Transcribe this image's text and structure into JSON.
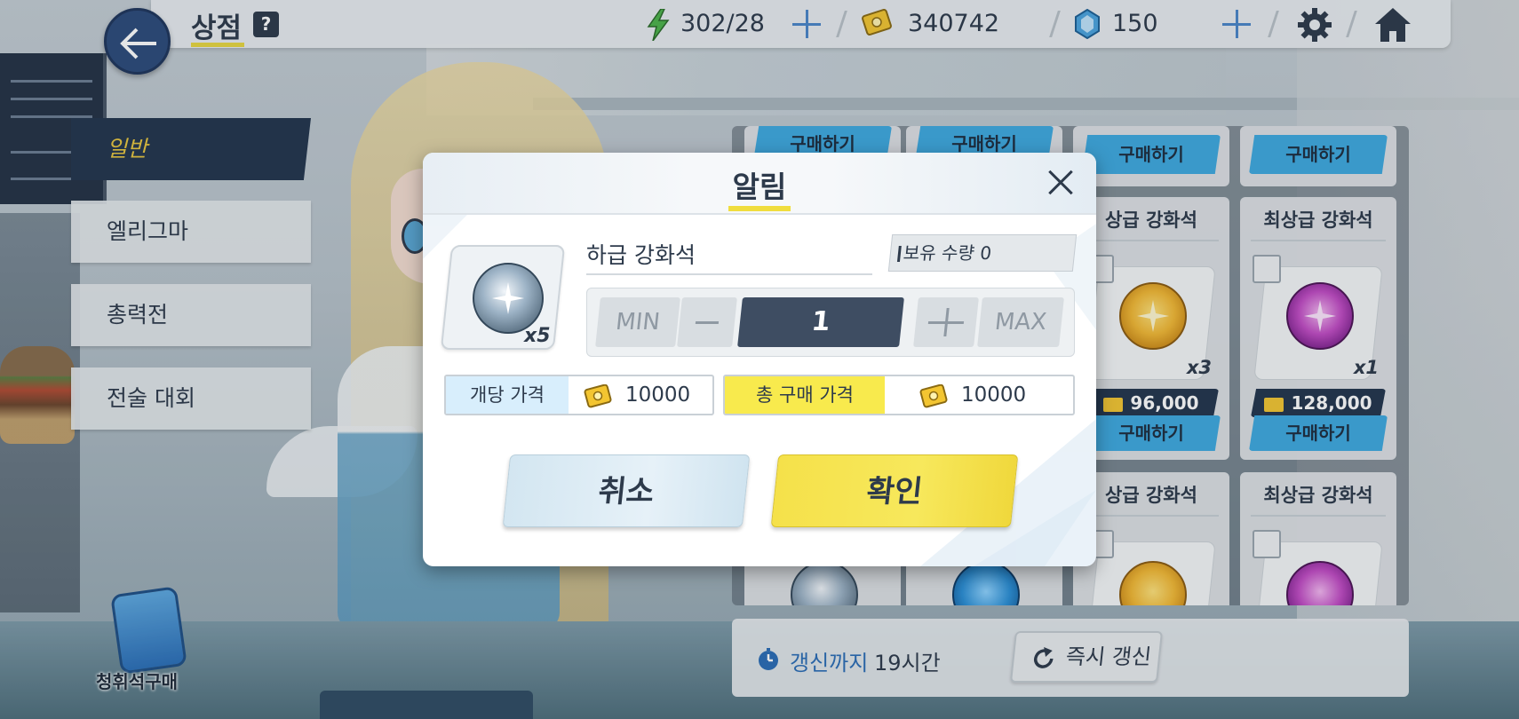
{
  "topbar": {
    "title": "상점",
    "help_label": "?",
    "ap": "302/28",
    "credits": "340742",
    "pyroxene": "150"
  },
  "tabs": [
    {
      "label": "일반",
      "active": true
    },
    {
      "label": "엘리그마",
      "active": false
    },
    {
      "label": "총력전",
      "active": false
    },
    {
      "label": "전술 대회",
      "active": false
    }
  ],
  "shop": {
    "buy_label": "구매하기",
    "cards": [
      {
        "name": "상급 강화석",
        "qty": "x3",
        "price": "96,000",
        "orb": "gold"
      },
      {
        "name": "최상급 강화석",
        "qty": "x1",
        "price": "128,000",
        "orb": "purple"
      },
      {
        "name": "상급 강화석",
        "orb": "gold"
      },
      {
        "name": "최상급 강화석",
        "orb": "purple"
      }
    ],
    "refresh_label": "갱신까지",
    "refresh_time": "19시간",
    "refresh_button": "즉시 갱신",
    "crystal_purchase": "청휘석구매"
  },
  "modal": {
    "title": "알림",
    "item_name": "하급 강화석",
    "item_qty": "x5",
    "owned_label": "보유 수량 0",
    "min_label": "MIN",
    "max_label": "MAX",
    "quantity": "1",
    "unit_price_label": "개당 가격",
    "unit_price": "10000",
    "total_price_label": "총 구매 가격",
    "total_price": "10000",
    "cancel_label": "취소",
    "confirm_label": "확인"
  },
  "colors": {
    "accent_yellow": "#f0dd3e",
    "navy": "#23354d",
    "buy_blue": "#3ea9e0",
    "link_blue": "#2b6db5"
  }
}
